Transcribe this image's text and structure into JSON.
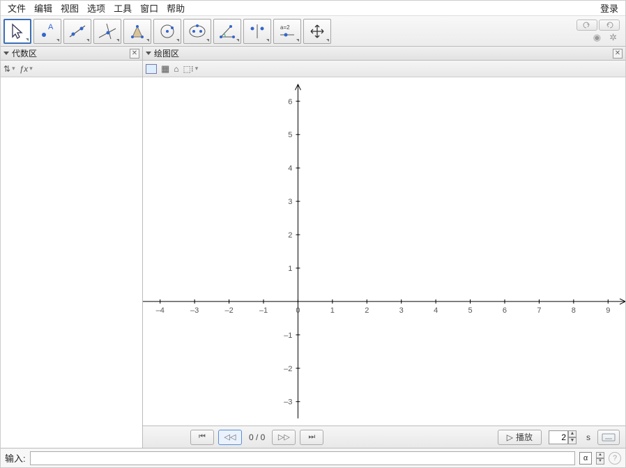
{
  "menu": {
    "file": "文件",
    "edit": "编辑",
    "view": "视图",
    "options": "选项",
    "tools": "工具",
    "window": "窗口",
    "help": "帮助",
    "login": "登录"
  },
  "panels": {
    "algebra_title": "代数区",
    "graphics_title": "绘图区"
  },
  "algebra_bar": {
    "fx": "ƒx"
  },
  "nav": {
    "count": "0 / 0",
    "play": "播放",
    "seconds": "s",
    "frame_value": "2"
  },
  "input": {
    "label": "输入:",
    "alpha": "α"
  },
  "icons": {
    "move": "move-icon",
    "point": "point-icon",
    "line": "line-icon",
    "perp": "perpendicular-icon",
    "polygon": "polygon-icon",
    "circle": "circle-icon",
    "conic": "conic-icon",
    "angle": "angle-icon",
    "reflect": "reflect-icon",
    "slider": "slider-icon",
    "move-view": "move-view-icon"
  },
  "chart_data": {
    "type": "scatter",
    "x_ticks": [
      -4,
      -3,
      -2,
      -1,
      0,
      1,
      2,
      3,
      4,
      5,
      6,
      7,
      8,
      9
    ],
    "y_ticks": [
      -3,
      -2,
      -1,
      1,
      2,
      3,
      4,
      5,
      6
    ],
    "xlim": [
      -4.5,
      9.5
    ],
    "ylim": [
      -3.5,
      6.5
    ],
    "series": [],
    "title": "",
    "xlabel": "",
    "ylabel": ""
  }
}
